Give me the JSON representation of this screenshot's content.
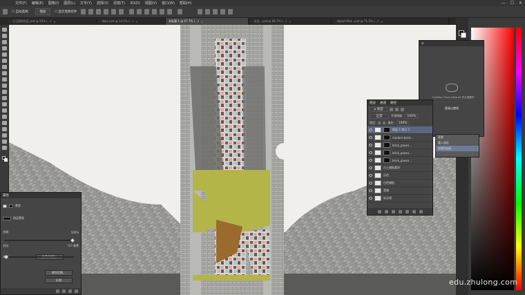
{
  "menu": {
    "items": [
      "文件(F)",
      "编辑(E)",
      "图像(I)",
      "图层(L)",
      "文字(Y)",
      "选择(S)",
      "滤镜(T)",
      "3D(D)",
      "视图(V)",
      "窗口(W)",
      "帮助(H)"
    ],
    "window_controls": [
      "—",
      "☐",
      "✕"
    ]
  },
  "options": {
    "tool_label": "☐ 自动选择：",
    "mode_select": "图层",
    "transform_label": "☐ 显示变换控件"
  },
  "tabs": [
    {
      "label": "…之汉国府社区.psd @ 50% (…)",
      "active": false
    },
    {
      "label": "…地pa.psd @ 33.5% (…)",
      "active": false
    },
    {
      "label": "未标题-1 @ 67.7% (…)",
      "active": true
    },
    {
      "label": "…社区…psd @ 66.7% (…)",
      "active": false
    },
    {
      "label": "…地pa(h)flat…psd @ 71.2% (…)",
      "active": false
    }
  ],
  "colors": {
    "canvas_bg": "#f0efeb",
    "paving": "#8f8f8c",
    "green": "#b3b549",
    "brown": "#9a6a2e",
    "ui_dark": "#3b3b3b",
    "ui_panel": "#454545",
    "selection": "#5a6780"
  },
  "layers_panel": {
    "tabs": [
      "图层",
      "通道",
      "路径"
    ],
    "kind_filter": "ρ 类型",
    "blend_mode": "正常",
    "opacity_label": "不透明度:",
    "opacity_value": "100%",
    "lock_label": "锁定:",
    "fill_label": "填充:",
    "fill_value": "100%",
    "layers": [
      {
        "name": "图层 1 拷贝 3",
        "selected": true,
        "thumb": "dark"
      },
      {
        "name": "modern-brick…",
        "selected": false,
        "thumb": "dark"
      },
      {
        "name": "brick_paven…",
        "selected": false,
        "thumb": "dark"
      },
      {
        "name": "brick_paven…",
        "selected": false,
        "thumb": "dark"
      },
      {
        "name": "brick_paven…",
        "selected": false,
        "thumb": "dark"
      },
      {
        "name": "白土铺贴素材",
        "selected": false,
        "thumb": "light"
      },
      {
        "name": "乐色",
        "selected": false,
        "thumb": "light"
      },
      {
        "name": "白色铺贴",
        "selected": false,
        "thumb": "light"
      },
      {
        "name": "黑铺",
        "selected": false,
        "thumb": "light"
      },
      {
        "name": "标注线",
        "selected": false,
        "thumb": "light"
      }
    ]
  },
  "cc_panel": {
    "text": "Creative Cloud Libraries 的云端素材",
    "button": "登录以使用"
  },
  "context_menu": {
    "items": [
      "背景",
      "载入选区",
      "存储为选区"
    ],
    "highlight_index": 2
  },
  "properties_panel": {
    "title": "属性",
    "section": "蒙版",
    "mask_label": "图层蒙版",
    "density_label": "浓度:",
    "density_value": "100%",
    "feather_label": "羽化:",
    "feather_value": "0.0 像素",
    "refine_label": "调整:",
    "buttons": [
      "选择并遮住…",
      "颜色范围…",
      "反相"
    ]
  },
  "watermark": "edu.zhulong.com",
  "icons": [
    "move-tool-icon",
    "marquee-icon",
    "lasso-icon",
    "crop-icon",
    "eyedropper-icon",
    "brush-icon",
    "eraser-icon",
    "gradient-icon",
    "pen-icon",
    "type-icon",
    "hand-icon",
    "zoom-icon",
    "eye-icon",
    "lock-icon",
    "link-icon",
    "trash-icon"
  ]
}
